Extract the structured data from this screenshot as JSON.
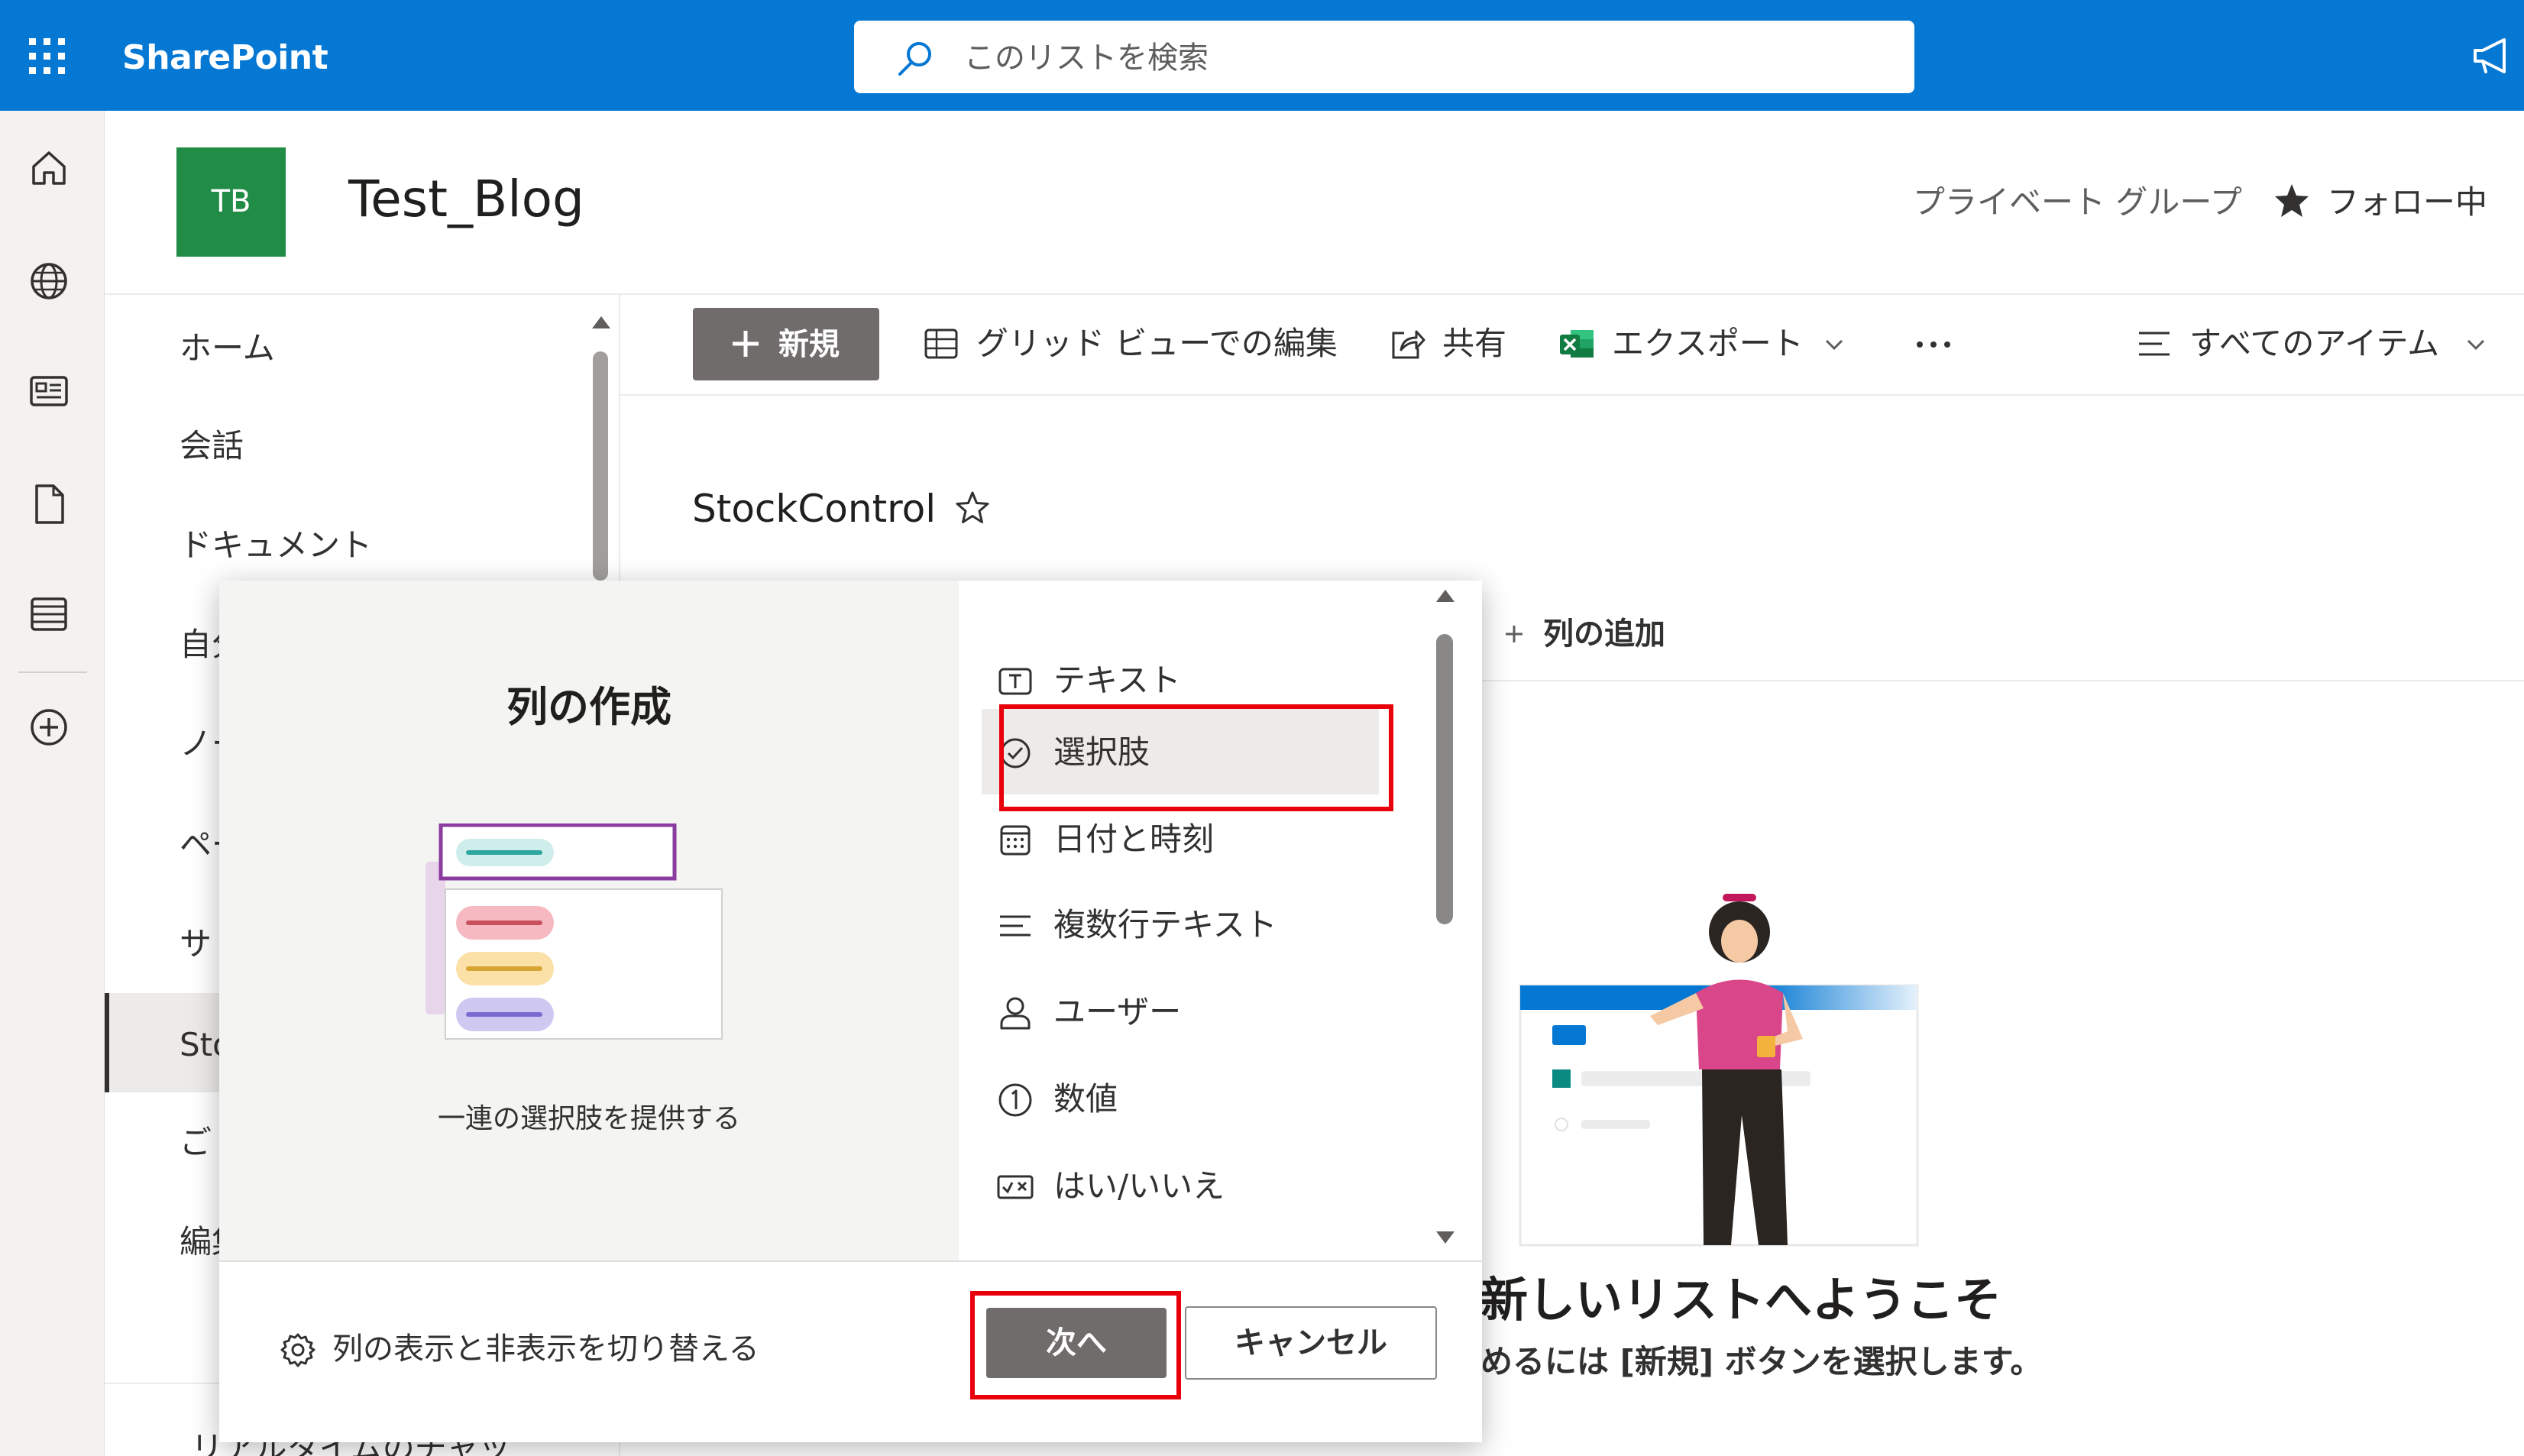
{
  "suitebar": {
    "app_name": "SharePoint",
    "search_placeholder": "このリストを検索"
  },
  "site": {
    "logo_initials": "TB",
    "title": "Test_Blog",
    "privacy": "プライベート グループ",
    "follow_label": "フォロー中"
  },
  "leftnav": {
    "items": [
      {
        "label": "ホーム"
      },
      {
        "label": "会話"
      },
      {
        "label": "ドキュメント"
      },
      {
        "label": "自分"
      },
      {
        "label": "ノー"
      },
      {
        "label": "ペー"
      },
      {
        "label": "サ"
      },
      {
        "label": "Sto"
      },
      {
        "label": "ご"
      },
      {
        "label": "編集"
      }
    ],
    "bottom_text": "リアルタイムのチャッ"
  },
  "commandbar": {
    "new_label": "新規",
    "grid_edit_label": "グリッド ビューでの編集",
    "share_label": "共有",
    "export_label": "エクスポート",
    "view_label": "すべてのアイテム"
  },
  "list": {
    "title": "StockControl",
    "add_column_label": "列の追加",
    "welcome_title": "新しいリストへようこそ",
    "welcome_subtitle": "めるには [新規] ボタンを選択します。"
  },
  "dialog": {
    "title": "列の作成",
    "description": "一連の選択肢を提供する",
    "column_types": [
      {
        "label": "テキスト",
        "icon": "text-type-icon"
      },
      {
        "label": "選択肢",
        "icon": "choice-icon"
      },
      {
        "label": "日付と時刻",
        "icon": "calendar-icon"
      },
      {
        "label": "複数行テキスト",
        "icon": "multiline-text-icon"
      },
      {
        "label": "ユーザー",
        "icon": "person-icon"
      },
      {
        "label": "数値",
        "icon": "number-icon"
      },
      {
        "label": "はい/いいえ",
        "icon": "yes-no-icon"
      }
    ],
    "selected_type": "選択肢",
    "toggle_columns_label": "列の表示と非表示を切り替える",
    "next_label": "次へ",
    "cancel_label": "キャンセル"
  },
  "colors": {
    "suitebar": "#0578d4",
    "site_logo": "#218c46",
    "primary_button": "#6f6c6b",
    "highlight": "#e8000b"
  }
}
